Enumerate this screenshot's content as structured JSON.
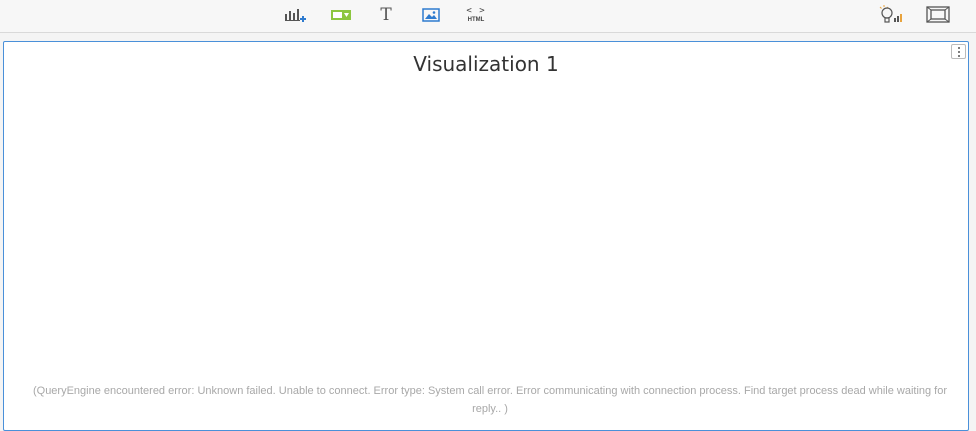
{
  "toolbar": {
    "tools": [
      {
        "name": "add-visualization",
        "icon": "bar-chart-plus-icon"
      },
      {
        "name": "add-filter",
        "icon": "filter-dropdown-icon",
        "color": "#8cc63f"
      },
      {
        "name": "add-text",
        "icon": "text-icon",
        "glyph": "T"
      },
      {
        "name": "add-image",
        "icon": "image-icon",
        "color": "#2e7bcf"
      },
      {
        "name": "add-html",
        "icon": "html-icon",
        "glyph": "< >",
        "label": "HTML"
      }
    ],
    "right_tools": [
      {
        "name": "insights",
        "icon": "lightbulb-bars-icon"
      },
      {
        "name": "presentation-mode",
        "icon": "presentation-frame-icon"
      }
    ]
  },
  "visualization": {
    "title": "Visualization 1",
    "menu_icon": "kebab-menu-icon",
    "error": "(QueryEngine encountered error: Unknown failed. Unable to connect. Error type: System call error. Error communicating with connection process. Find target process dead while waiting for reply.. )"
  },
  "colors": {
    "panel_border": "#4a90d9",
    "accent_blue": "#2e7bcf",
    "accent_green": "#8cc63f",
    "error_text": "#a8a8a8"
  }
}
